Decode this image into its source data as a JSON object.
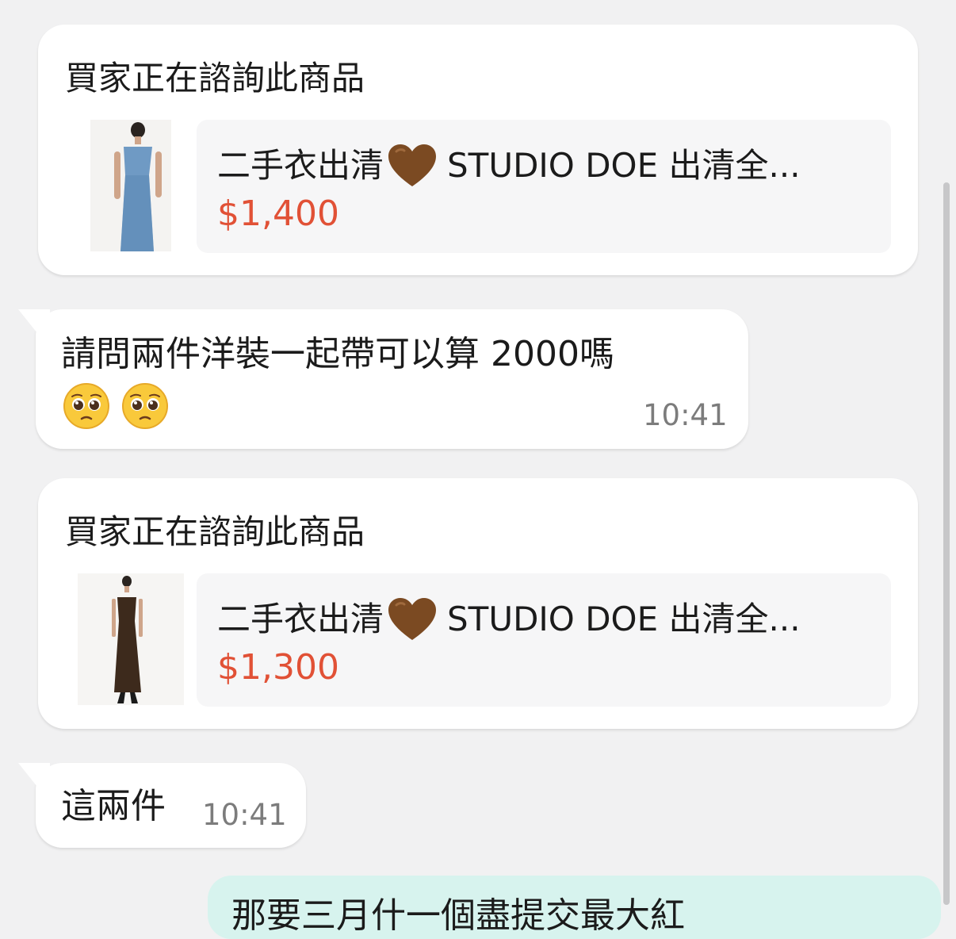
{
  "messages": [
    {
      "type": "product_inquiry",
      "header": "買家正在諮詢此商品",
      "product": {
        "title": "二手衣出清",
        "title_suffix": "STUDIO DOE 出清全...",
        "emoji": "brown-heart",
        "price": "$1,400",
        "image": "blue-dress"
      }
    },
    {
      "type": "incoming_text",
      "text": "請問兩件洋裝一起帶可以算 2000嗎",
      "emojis": [
        "pleading-face",
        "pleading-face"
      ],
      "time": "10:41"
    },
    {
      "type": "product_inquiry",
      "header": "買家正在諮詢此商品",
      "product": {
        "title": "二手衣出清",
        "title_suffix": "STUDIO DOE 出清全...",
        "emoji": "brown-heart",
        "price": "$1,300",
        "image": "brown-dress"
      }
    },
    {
      "type": "incoming_text",
      "text": "這兩件",
      "time": "10:41"
    },
    {
      "type": "outgoing_text",
      "text": "那要三月什一個盡提交最大紅",
      "partially_visible": true
    }
  ],
  "colors": {
    "background": "#f1f1f2",
    "price": "#e15136",
    "outgoing_bubble": "#d7f3ee",
    "timestamp": "#7c7c7c"
  }
}
